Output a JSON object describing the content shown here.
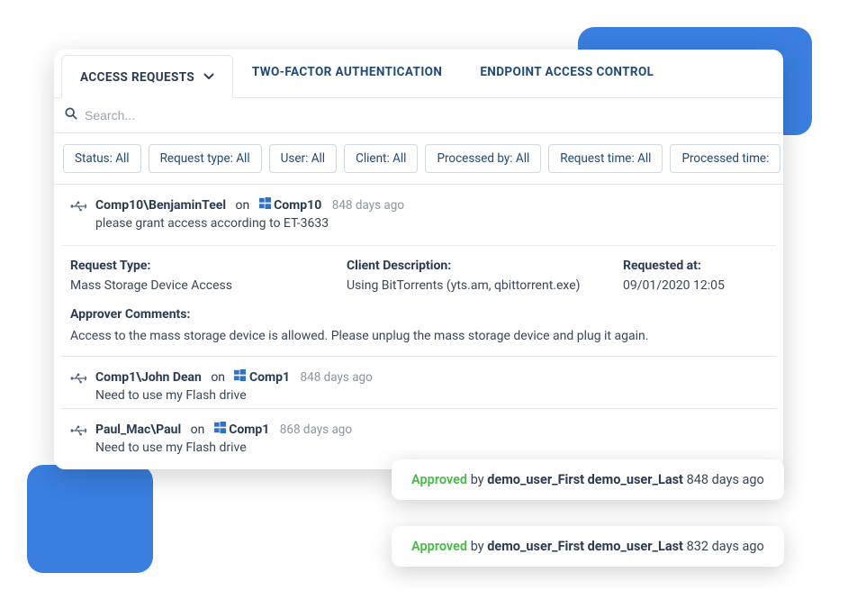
{
  "tabs": {
    "items": [
      {
        "label": "ACCESS REQUESTS",
        "active": true,
        "has_dropdown": true
      },
      {
        "label": "TWO-FACTOR AUTHENTICATION",
        "active": false
      },
      {
        "label": "ENDPOINT ACCESS CONTROL",
        "active": false
      }
    ]
  },
  "search": {
    "placeholder": "Search..."
  },
  "filters": [
    "Status: All",
    "Request type: All",
    "User: All",
    "Client: All",
    "Processed by: All",
    "Request time: All",
    "Processed time:"
  ],
  "requests": [
    {
      "user": "Comp10\\BenjaminTeel",
      "on_word": "on",
      "host": "Comp10",
      "age": "848 days ago",
      "message": "please grant access according to ET-3633",
      "details": {
        "type_label": "Request Type:",
        "type_value": "Mass Storage Device Access",
        "client_label": "Client Description:",
        "client_value": "Using BitTorrents (yts.am, qbittorrent.exe)",
        "requested_label": "Requested at:",
        "requested_value": "09/01/2020 12:05"
      },
      "approver_label": "Approver Comments:",
      "approver_value": "Access to the mass storage device is allowed. Please unplug the mass storage device and plug it again."
    },
    {
      "user": "Comp1\\John Dean",
      "on_word": "on",
      "host": "Comp1",
      "age": "848 days ago",
      "message": "Need to use my Flash drive"
    },
    {
      "user": "Paul_Mac\\Paul",
      "on_word": "on",
      "host": "Comp1",
      "age": "868 days ago",
      "message": "Need to use my Flash drive"
    }
  ],
  "toasts": [
    {
      "status": "Approved",
      "by_word": "by",
      "approver": "demo_user_First demo_user_Last",
      "age": "848 days ago"
    },
    {
      "status": "Approved",
      "by_word": "by",
      "approver": "demo_user_First demo_user_Last",
      "age": "832 days ago"
    }
  ]
}
